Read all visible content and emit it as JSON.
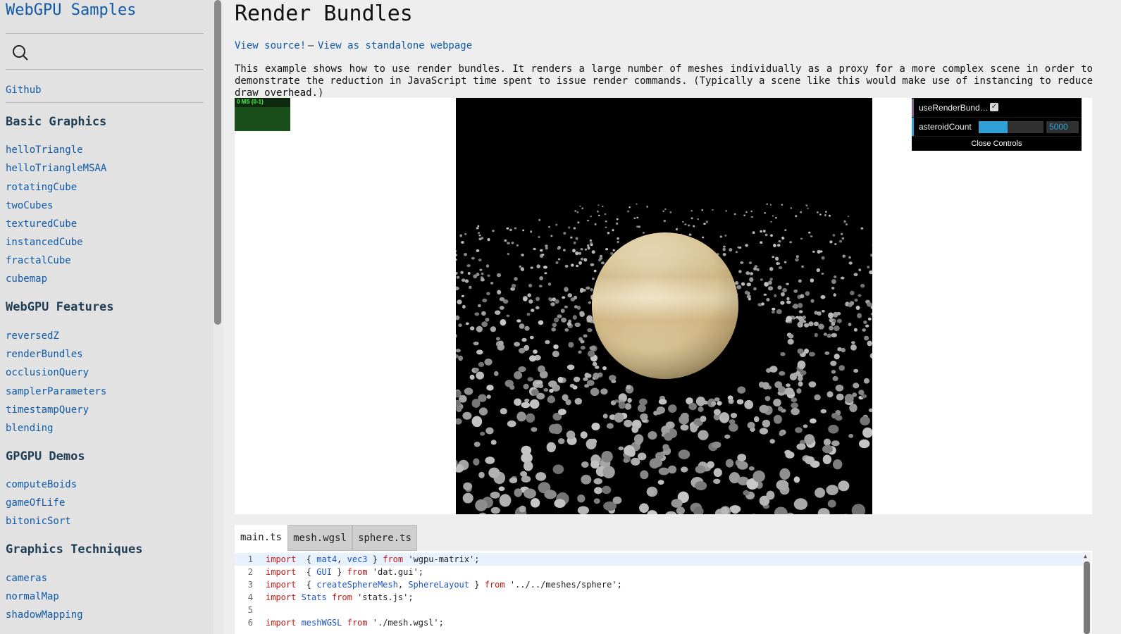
{
  "sidebar": {
    "title": "WebGPU Samples",
    "github": "Github",
    "sections": [
      {
        "title": "Basic Graphics",
        "items": [
          "helloTriangle",
          "helloTriangleMSAA",
          "rotatingCube",
          "twoCubes",
          "texturedCube",
          "instancedCube",
          "fractalCube",
          "cubemap"
        ]
      },
      {
        "title": "WebGPU Features",
        "items": [
          "reversedZ",
          "renderBundles",
          "occlusionQuery",
          "samplerParameters",
          "timestampQuery",
          "blending"
        ]
      },
      {
        "title": "GPGPU Demos",
        "items": [
          "computeBoids",
          "gameOfLife",
          "bitonicSort"
        ]
      },
      {
        "title": "Graphics Techniques",
        "items": [
          "cameras",
          "normalMap",
          "shadowMapping"
        ]
      }
    ]
  },
  "main": {
    "title": "Render Bundles",
    "view_source": "View source!",
    "separator": "—",
    "view_standalone": "View as standalone webpage",
    "description": "This example shows how to use render bundles. It renders a large number of meshes individually as a proxy for a more complex scene in order to demonstrate the reduction in JavaScript time spent to issue render commands. (Typically a scene like this would make use of instancing to reduce draw overhead.)"
  },
  "stats": {
    "label": "0 MS (0-1)"
  },
  "gui": {
    "use_render_bundles_label": "useRenderBund…",
    "use_render_bundles_checked": true,
    "asteroid_count_label": "asteroidCount",
    "asteroid_count_value": "5000",
    "asteroid_count_fraction": 0.45,
    "close_label": "Close Controls"
  },
  "tabs": [
    "main.ts",
    "mesh.wgsl",
    "sphere.ts"
  ],
  "code_lines": [
    {
      "n": "1",
      "tokens": [
        [
          "kw",
          "import"
        ],
        [
          "",
          "  { "
        ],
        [
          "id",
          "mat4"
        ],
        [
          "",
          ", "
        ],
        [
          "id",
          "vec3"
        ],
        [
          "",
          " } "
        ],
        [
          "kw",
          "from"
        ],
        [
          "str",
          " 'wgpu-matrix'"
        ],
        [
          "",
          ";"
        ]
      ]
    },
    {
      "n": "2",
      "tokens": [
        [
          "kw",
          "import"
        ],
        [
          "",
          "  { "
        ],
        [
          "id",
          "GUI"
        ],
        [
          "",
          " } "
        ],
        [
          "kw",
          "from"
        ],
        [
          "str",
          " 'dat.gui'"
        ],
        [
          "",
          ";"
        ]
      ]
    },
    {
      "n": "3",
      "tokens": [
        [
          "kw",
          "import"
        ],
        [
          "",
          "  { "
        ],
        [
          "id",
          "createSphereMesh"
        ],
        [
          "",
          ", "
        ],
        [
          "id",
          "SphereLayout"
        ],
        [
          "",
          " } "
        ],
        [
          "kw",
          "from"
        ],
        [
          "str",
          " '../../meshes/sphere'"
        ],
        [
          "",
          ";"
        ]
      ]
    },
    {
      "n": "4",
      "tokens": [
        [
          "kw",
          "import"
        ],
        [
          "id",
          " Stats "
        ],
        [
          "kw",
          "from"
        ],
        [
          "str",
          " 'stats.js'"
        ],
        [
          "",
          ";"
        ]
      ]
    },
    {
      "n": "5",
      "tokens": []
    },
    {
      "n": "6",
      "tokens": [
        [
          "kw",
          "import"
        ],
        [
          "id",
          " meshWGSL "
        ],
        [
          "kw",
          "from"
        ],
        [
          "str",
          " './mesh.wgsl'"
        ],
        [
          "",
          ";"
        ]
      ]
    }
  ]
}
